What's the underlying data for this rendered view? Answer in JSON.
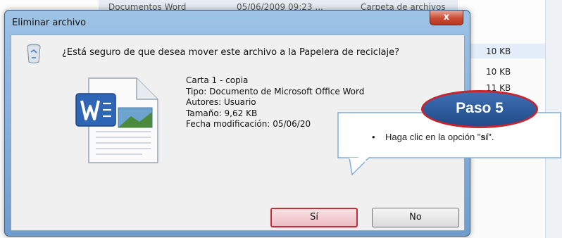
{
  "background": {
    "columns": [
      "Documentos Word",
      "05/06/2009 09:23 ...",
      "Carpeta de archivos"
    ],
    "sizes": [
      "10 KB",
      "10 KB",
      "11 KB"
    ]
  },
  "dialog": {
    "title": "Eliminar archivo",
    "close_label": "x",
    "question": "¿Está seguro de que desea mover este archivo a la Papelera de reciclaje?",
    "file": {
      "name": "Carta 1 - copia",
      "type": "Tipo: Documento de Microsoft Office Word",
      "authors": "Autores: Usuario",
      "size": "Tamaño: 9,62 KB",
      "modified": "Fecha modificación: 05/06/20"
    },
    "yes_label": "Sí",
    "no_label": "No"
  },
  "callout": {
    "badge": "Paso 5",
    "text_prefix": "Haga clic en la opción \"",
    "text_bold": "sí",
    "text_suffix": "\"."
  },
  "colors": {
    "highlight_red": "#c0303a",
    "badge_blue": "#2d5c9e"
  },
  "icons": [
    "recycle-bin-icon",
    "word-document-icon",
    "close-icon"
  ]
}
